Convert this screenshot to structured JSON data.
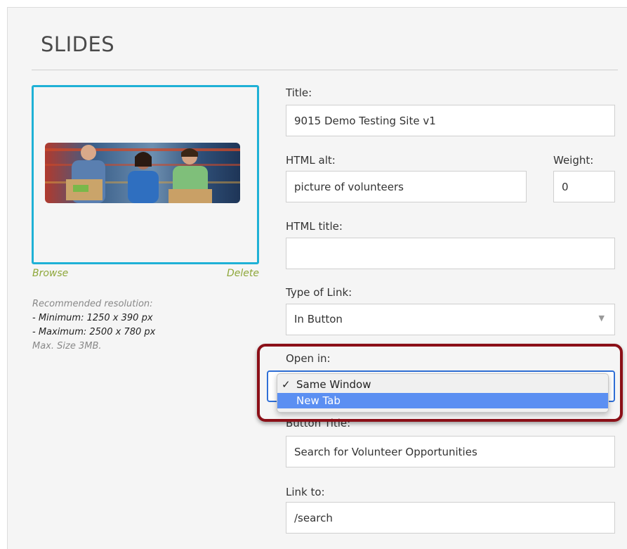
{
  "page": {
    "title": "SLIDES"
  },
  "image_panel": {
    "browse_label": "Browse",
    "delete_label": "Delete",
    "recommended_label": "Recommended resolution:",
    "minimum_label": "- Minimum: 1250 x 390 px",
    "maximum_label": "- Maximum: 2500 x 780 px",
    "max_size_label": "Max. Size 3MB."
  },
  "form": {
    "title": {
      "label": "Title:",
      "value": "9015 Demo Testing Site v1"
    },
    "html_alt": {
      "label": "HTML alt:",
      "value": "picture of volunteers"
    },
    "weight": {
      "label": "Weight:",
      "value": "0"
    },
    "html_title": {
      "label": "HTML title:",
      "value": ""
    },
    "type_of_link": {
      "label": "Type of Link:",
      "value": "In Button",
      "arrow": "▼"
    },
    "open_in": {
      "label": "Open in:",
      "options": [
        {
          "label": "Same Window",
          "selected": true,
          "check": "✓"
        },
        {
          "label": "New Tab",
          "highlighted": true
        }
      ]
    },
    "button_title": {
      "label": "Button Title:",
      "value": "Search for Volunteer Opportunities"
    },
    "link_to": {
      "label": "Link to:",
      "value": "/search"
    }
  },
  "colors": {
    "accent_border": "#1fb1d6",
    "link_green": "#8ea73a",
    "highlight_ring": "#8b1018",
    "option_highlight": "#5b8ff2",
    "focus_blue": "#2f6fd6"
  }
}
